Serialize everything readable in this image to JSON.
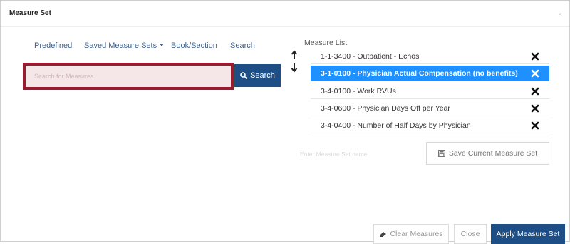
{
  "modal": {
    "title": "Measure Set",
    "close_glyph": "×"
  },
  "tabs": [
    {
      "label": "Predefined"
    },
    {
      "label": "Saved Measure Sets"
    },
    {
      "label": "Book/Section"
    },
    {
      "label": "Search"
    }
  ],
  "search": {
    "placeholder": "Search for Measures",
    "value": "",
    "button_label": "Search",
    "highlight_color": "#9b1b30"
  },
  "measure_list": {
    "title": "Measure List",
    "move_up_icon": "arrow-up-icon",
    "move_down_icon": "arrow-down-icon",
    "selected_index": 1,
    "selected_color": "#1e90ff",
    "items": [
      {
        "label": "1-1-3400 - Outpatient - Echos"
      },
      {
        "label": "3-1-0100 - Physician Actual Compensation (no benefits)"
      },
      {
        "label": "3-4-0100 - Work RVUs"
      },
      {
        "label": "3-4-0600 - Physician Days Off per Year"
      },
      {
        "label": "3-4-0400 - Number of Half Days by Physician"
      }
    ]
  },
  "save": {
    "name_placeholder": "Enter Measure Set name",
    "button_label": "Save Current Measure Set"
  },
  "footer": {
    "clear_label": "Clear Measures",
    "close_label": "Close",
    "apply_label": "Apply Measure Set",
    "primary_color": "#1d4f86"
  }
}
